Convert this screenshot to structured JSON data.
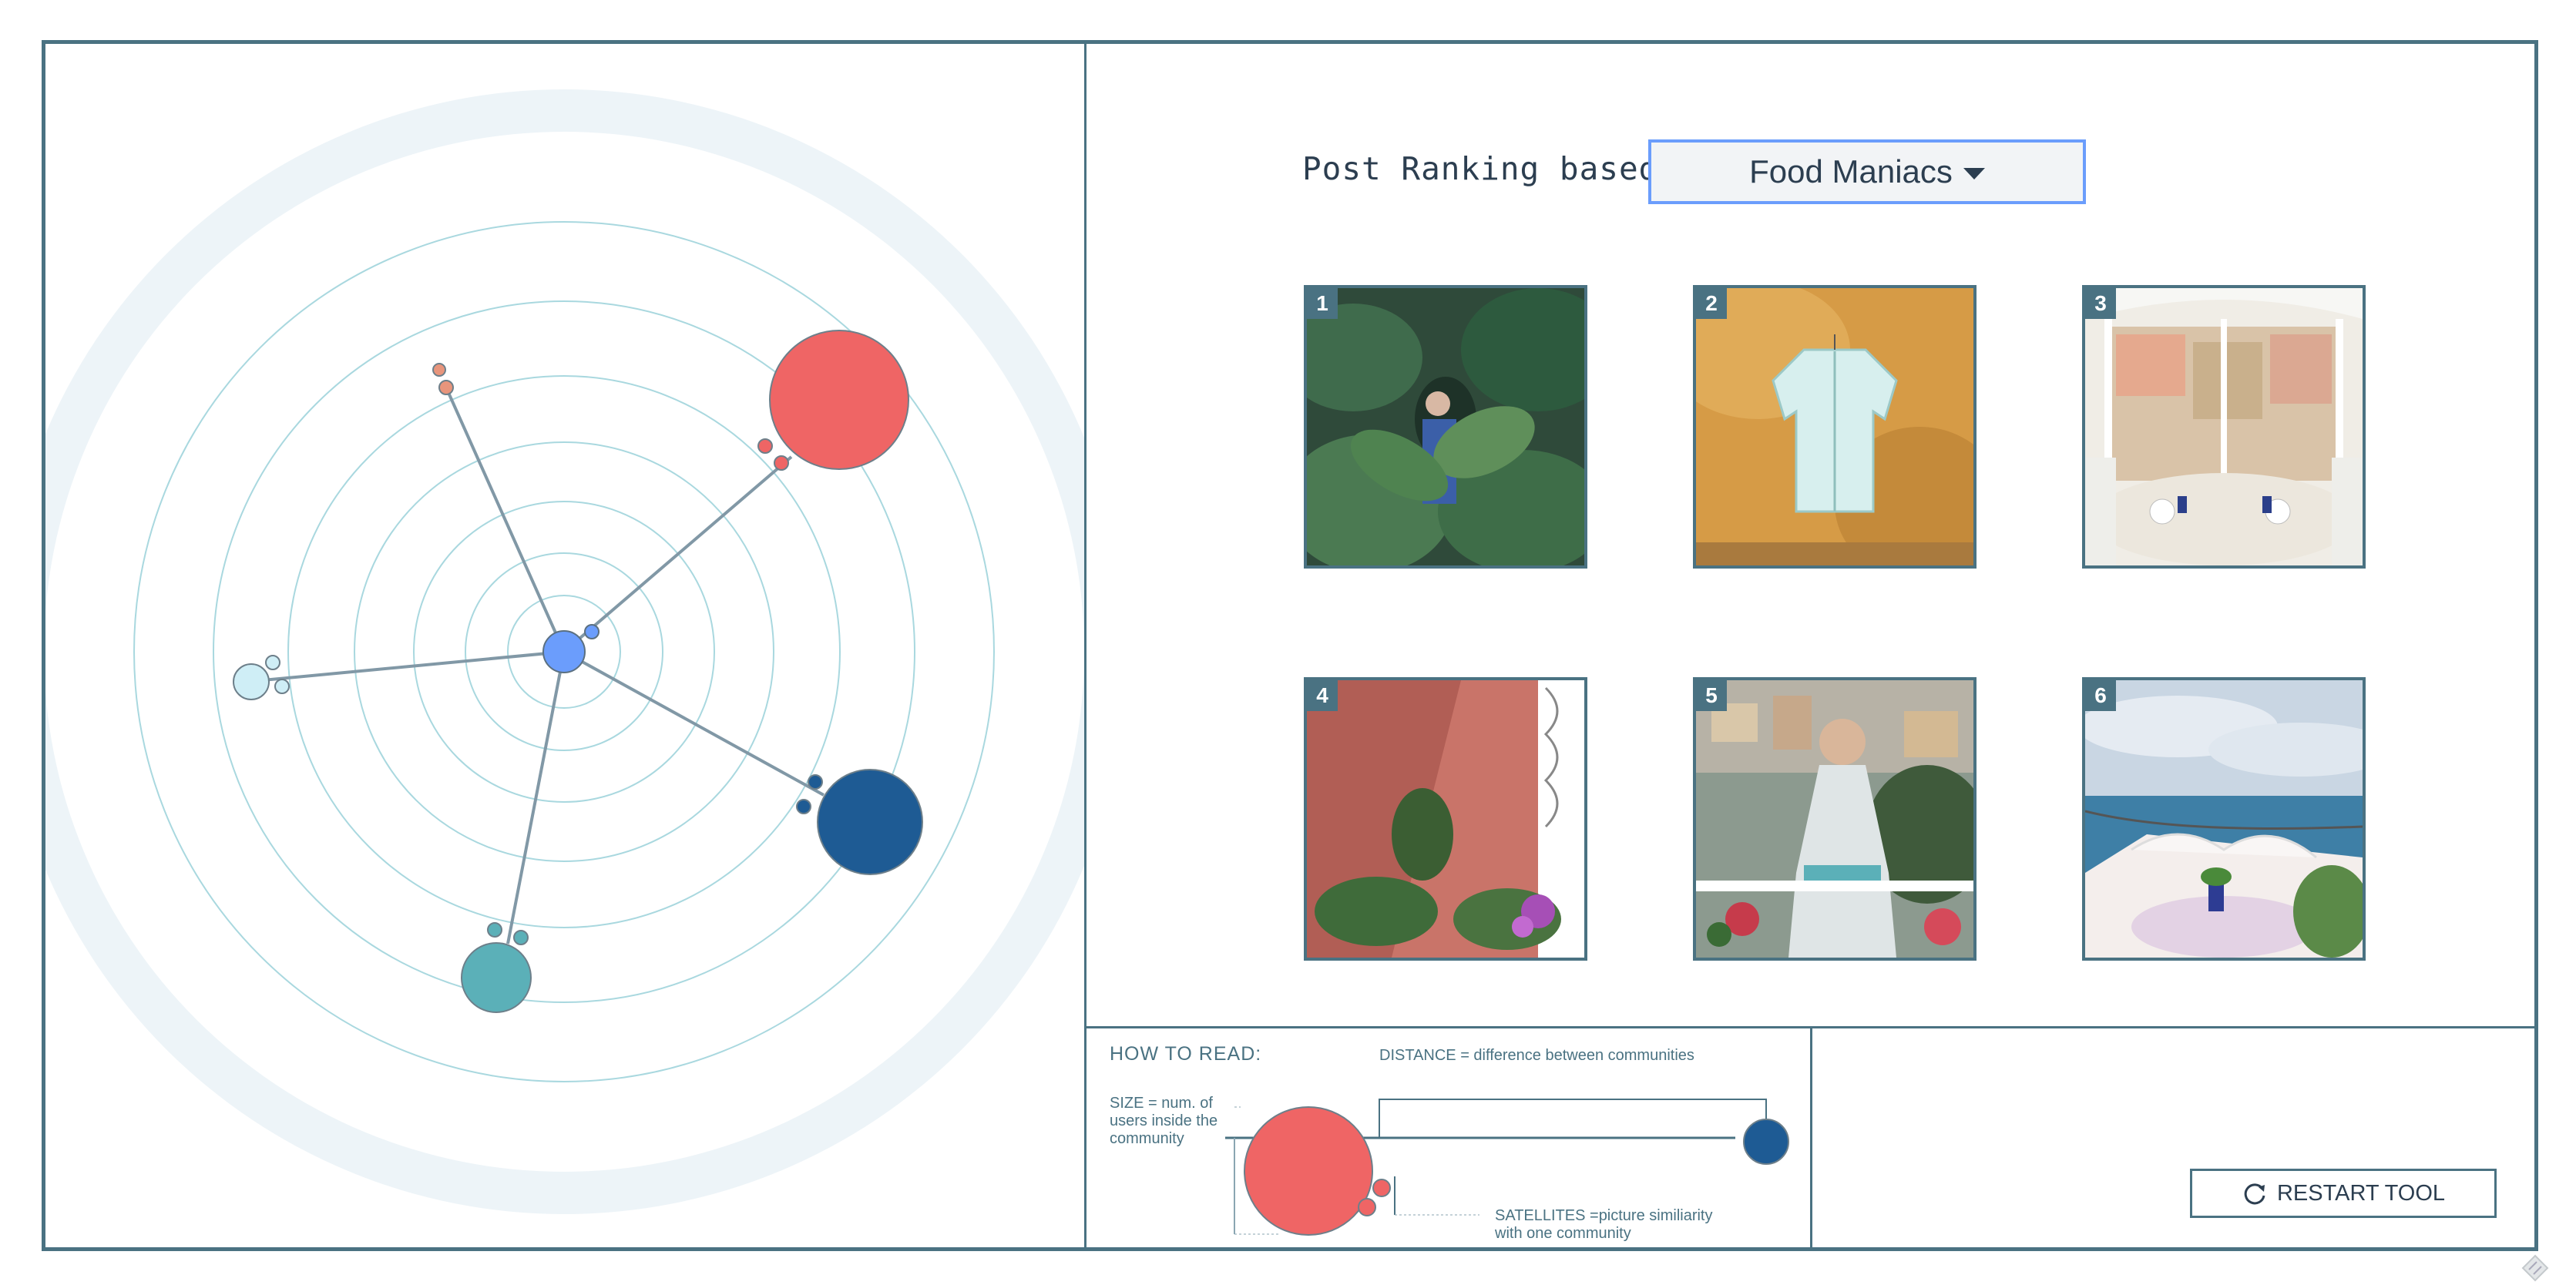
{
  "header": {
    "ranking_label": "Post Ranking based on",
    "dropdown_selected": "Food Maniacs"
  },
  "posts": [
    {
      "rank": "1",
      "scene": "jungle-portrait"
    },
    {
      "rank": "2",
      "scene": "shirt-on-wall"
    },
    {
      "rank": "3",
      "scene": "terrace-dining"
    },
    {
      "rank": "4",
      "scene": "pink-wall-plants"
    },
    {
      "rank": "5",
      "scene": "woman-on-balcony"
    },
    {
      "rank": "6",
      "scene": "sea-view-terrace"
    }
  ],
  "legend": {
    "title": "HOW TO READ:",
    "distance": "DISTANCE = difference between communities",
    "size_lines": [
      "SIZE = num. of",
      "users inside the",
      "community"
    ],
    "satellites_lines": [
      "SATELLITES =picture similiarity",
      "with one community"
    ]
  },
  "restart_label": "RESTART TOOL",
  "colors": {
    "frame": "#4a7282",
    "center_node": "#6b9dfc",
    "community_red": "#ef6565",
    "community_navy": "#1e5b94",
    "community_teal": "#5bb0b8",
    "community_lightblue": "#cfeef6",
    "community_salmon": "#e8957c"
  },
  "icons": {
    "dropdown": "caret-down-icon",
    "restart": "refresh-icon"
  }
}
